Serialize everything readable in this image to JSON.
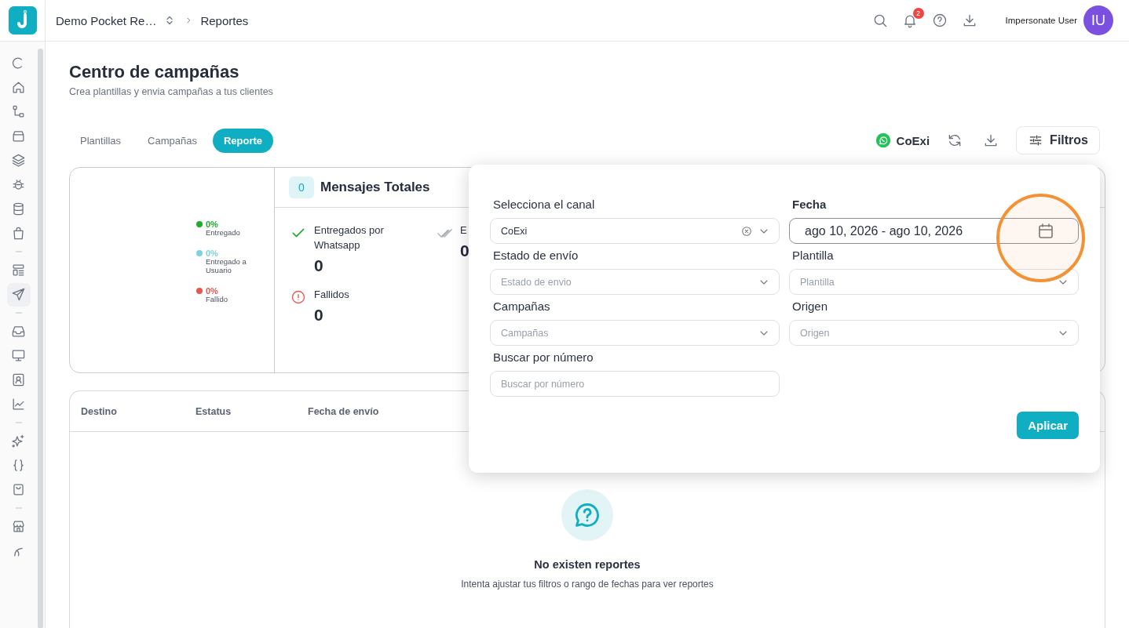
{
  "header": {
    "breadcrumb": [
      {
        "label": "Demo Pocket Re…",
        "kind": "switcher"
      },
      {
        "label": "Reportes",
        "kind": "current"
      }
    ],
    "notification_count": "2",
    "user": {
      "name": "Impersonate User",
      "initials": "IU"
    }
  },
  "sidebar": {
    "items": [
      {
        "kind": "item",
        "selected": false
      },
      {
        "kind": "item",
        "selected": false
      },
      {
        "kind": "item",
        "selected": false
      },
      {
        "kind": "item",
        "selected": false
      },
      {
        "kind": "item",
        "selected": false
      },
      {
        "kind": "item",
        "selected": false
      },
      {
        "kind": "item",
        "selected": false
      },
      {
        "kind": "item",
        "selected": false
      },
      {
        "kind": "divider"
      },
      {
        "kind": "item",
        "selected": false
      },
      {
        "kind": "item",
        "selected": true
      },
      {
        "kind": "divider"
      },
      {
        "kind": "item",
        "selected": false
      },
      {
        "kind": "item",
        "selected": false
      },
      {
        "kind": "item",
        "selected": false
      },
      {
        "kind": "item",
        "selected": false
      },
      {
        "kind": "divider"
      },
      {
        "kind": "item",
        "selected": false
      },
      {
        "kind": "item",
        "selected": false
      },
      {
        "kind": "item",
        "selected": false
      },
      {
        "kind": "divider"
      },
      {
        "kind": "item",
        "selected": false
      },
      {
        "kind": "item",
        "selected": false
      }
    ]
  },
  "page": {
    "title": "Centro de campañas",
    "subtitle": "Crea plantillas y envia campañas a tus clientes",
    "tabs": [
      {
        "label": "Plantillas",
        "selected": false
      },
      {
        "label": "Campañas",
        "selected": false
      },
      {
        "label": "Reporte",
        "selected": true
      }
    ],
    "channel": "CoExi",
    "filter_button": "Filtros"
  },
  "stats": {
    "legend": [
      {
        "value": "0%",
        "label": "Entregado",
        "color": "#1fae2b"
      },
      {
        "value": "0%",
        "label": "Entregado a Usuario",
        "color": "#7dd3df"
      },
      {
        "value": "0%",
        "label": "Fallido",
        "color": "#e5584f"
      }
    ],
    "total": {
      "count": "0",
      "label": "Mensajes Totales"
    },
    "items": [
      {
        "kind": "delivered",
        "label": "Entregados por Whatsapp",
        "value": "0"
      },
      {
        "kind": "read",
        "label": "E",
        "value": "0"
      },
      {
        "kind": "failed",
        "label": "Fallidos",
        "value": "0"
      }
    ]
  },
  "table": {
    "columns": [
      "Destino",
      "Estatus",
      "Fecha de envío"
    ],
    "empty": {
      "title": "No existen reportes",
      "message": "Intenta ajustar tus filtros o rango de fechas para ver reportes"
    }
  },
  "filters": {
    "fields": [
      {
        "label": "Selecciona el canal",
        "kind": "select",
        "value": "CoExi",
        "clearable": true,
        "focused": false
      },
      {
        "label": "Fecha",
        "kind": "date",
        "value": "ago 10, 2026 - ago 10, 2026",
        "focused": true
      },
      {
        "label": "Estado de envío",
        "kind": "select",
        "placeholder": "Estado de envio",
        "clearable": false,
        "focused": false
      },
      {
        "label": "Plantilla",
        "kind": "select",
        "placeholder": "Plantilla",
        "clearable": false,
        "focused": false
      },
      {
        "label": "Campañas",
        "kind": "select",
        "placeholder": "Campañas",
        "clearable": false,
        "focused": false
      },
      {
        "label": "Origen",
        "kind": "select",
        "placeholder": "Origen",
        "clearable": false,
        "focused": false
      },
      {
        "label": "Buscar por número",
        "kind": "text",
        "placeholder": "Buscar por número",
        "focused": false
      }
    ],
    "apply_button": "Aplicar"
  },
  "annotation": {
    "kind": "circle"
  }
}
